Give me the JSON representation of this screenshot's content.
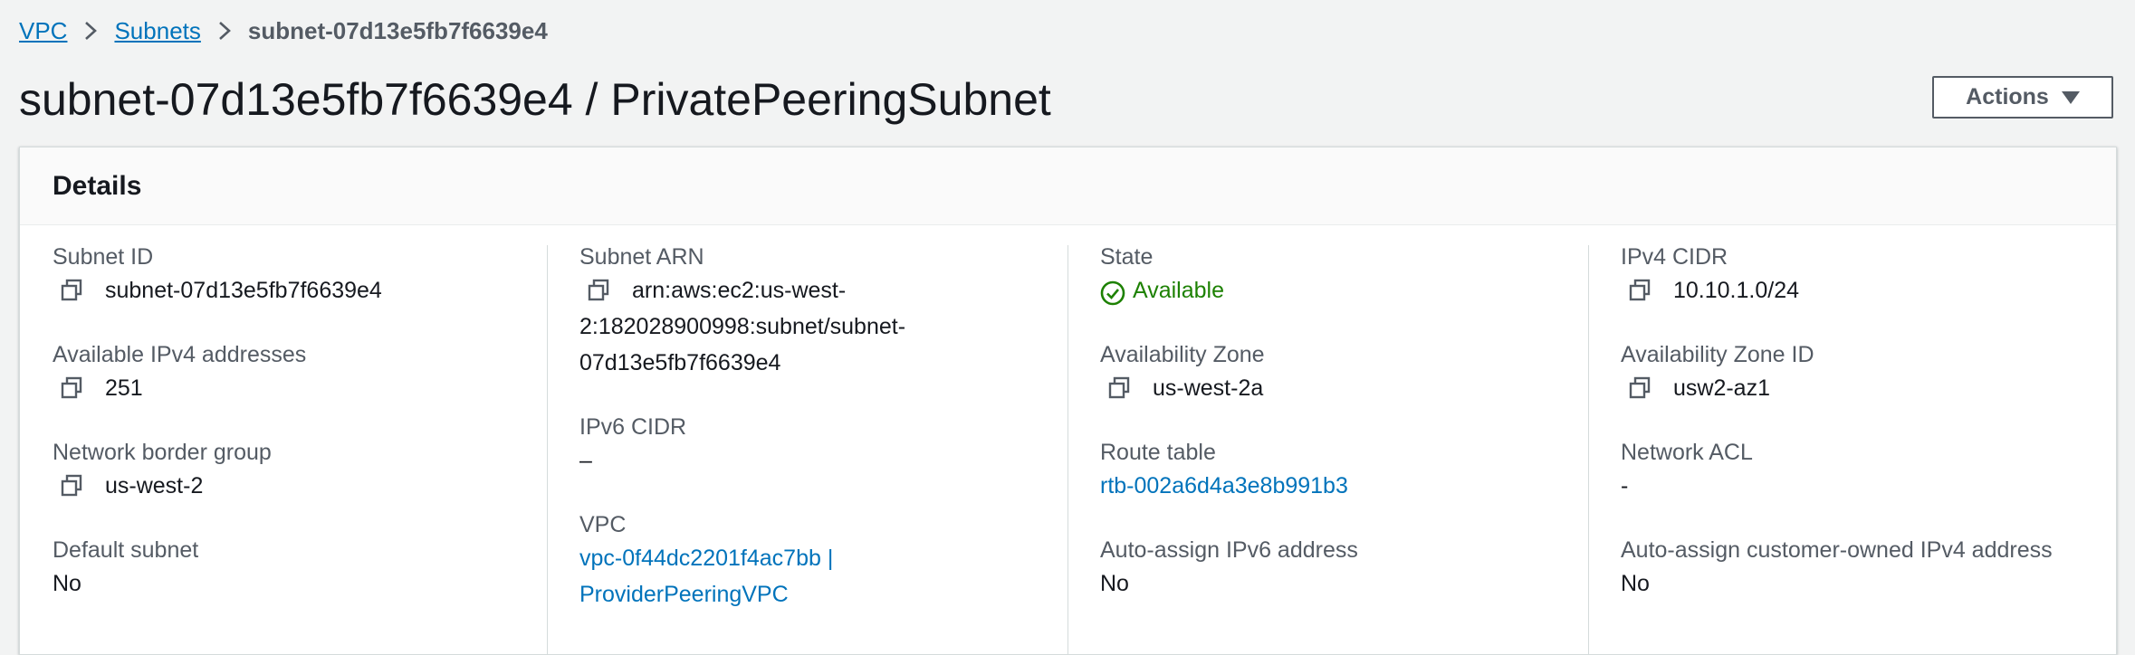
{
  "breadcrumb": {
    "items": [
      "VPC",
      "Subnets"
    ],
    "current": "subnet-07d13e5fb7f6639e4"
  },
  "page": {
    "title": "subnet-07d13e5fb7f6639e4 / PrivatePeeringSubnet",
    "actions_label": "Actions"
  },
  "details": {
    "title": "Details",
    "subnet_id": {
      "label": "Subnet ID",
      "value": "subnet-07d13e5fb7f6639e4"
    },
    "available_ipv4": {
      "label": "Available IPv4 addresses",
      "value": "251"
    },
    "network_border_group": {
      "label": "Network border group",
      "value": "us-west-2"
    },
    "default_subnet": {
      "label": "Default subnet",
      "value": "No"
    },
    "subnet_arn": {
      "label": "Subnet ARN",
      "line1": "arn:aws:ec2:us-west-",
      "line2": "2:182028900998:subnet/subnet-",
      "line3": "07d13e5fb7f6639e4"
    },
    "ipv6_cidr": {
      "label": "IPv6 CIDR",
      "value": "–"
    },
    "vpc": {
      "label": "VPC",
      "line1": "vpc-0f44dc2201f4ac7bb |",
      "line2": "ProviderPeeringVPC"
    },
    "state": {
      "label": "State",
      "value": "Available"
    },
    "availability_zone": {
      "label": "Availability Zone",
      "value": "us-west-2a"
    },
    "route_table": {
      "label": "Route table",
      "value": "rtb-002a6d4a3e8b991b3"
    },
    "auto_assign_ipv6": {
      "label": "Auto-assign IPv6 address",
      "value": "No"
    },
    "ipv4_cidr": {
      "label": "IPv4 CIDR",
      "value": "10.10.1.0/24"
    },
    "availability_zone_id": {
      "label": "Availability Zone ID",
      "value": "usw2-az1"
    },
    "network_acl": {
      "label": "Network ACL",
      "value": "-"
    },
    "auto_assign_customer_owned_ipv4": {
      "label": "Auto-assign customer-owned IPv4 address",
      "value": "No"
    }
  },
  "colors": {
    "link": "#0073bb",
    "success": "#1d8102",
    "text": "#16191f",
    "label": "#545b64",
    "background": "#f2f3f3"
  },
  "icons": {
    "copy": "copy-icon",
    "breadcrumb_separator": "chevron-right-icon",
    "status": "check-circle-icon",
    "dropdown": "caret-down-icon"
  }
}
